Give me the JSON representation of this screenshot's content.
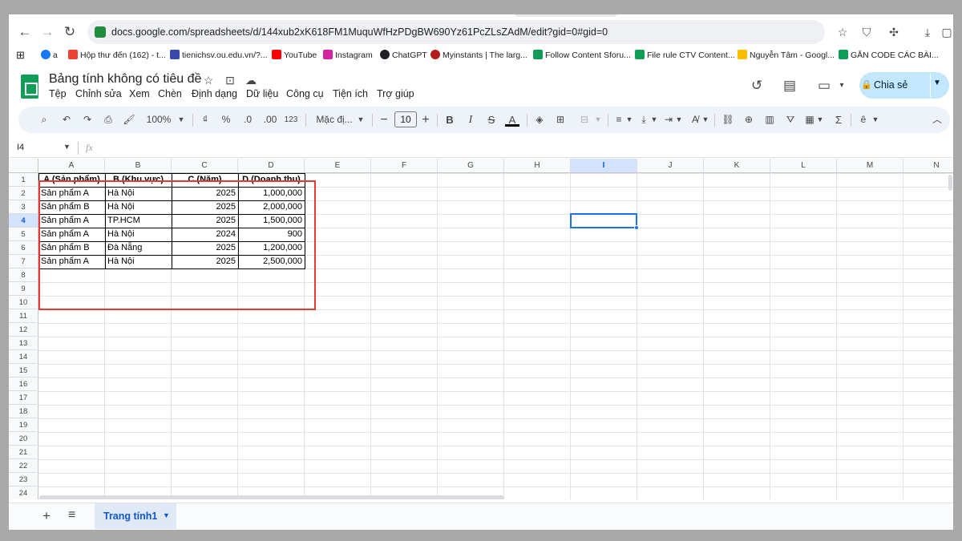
{
  "browser": {
    "url": "docs.google.com/spreadsheets/d/144xub2xK618FM1MuquWfHzPDgBW690Yz61PcZLsZAdM/edit?gid=0#gid=0",
    "bookmarks": [
      {
        "label": "a",
        "icon": "facebook-icon",
        "color": "#1877f2"
      },
      {
        "label": "Hộp thư đến (162) - t...",
        "icon": "gmail-icon",
        "color": "#ea4335"
      },
      {
        "label": "tienichsv.ou.edu.vn/?...",
        "icon": "edge-icon",
        "color": "#3949ab"
      },
      {
        "label": "YouTube",
        "icon": "youtube-icon",
        "color": "#ff0000"
      },
      {
        "label": "Instagram",
        "icon": "instagram-icon",
        "color": "#d6249f"
      },
      {
        "label": "ChatGPT",
        "icon": "chatgpt-icon",
        "color": "#202124"
      },
      {
        "label": "Myinstants | The larg...",
        "icon": "myinstants-icon",
        "color": "#b71c1c"
      },
      {
        "label": "Follow Content Sforu...",
        "icon": "sheets-icon",
        "color": "#0f9d58"
      },
      {
        "label": "File rule CTV Content...",
        "icon": "sheets-icon",
        "color": "#0f9d58"
      },
      {
        "label": "Nguyễn Tâm - Googl...",
        "icon": "drive-icon",
        "color": "#fbbc04"
      },
      {
        "label": "GẮN CODE CÁC BÀI...",
        "icon": "sheets-icon",
        "color": "#0f9d58"
      }
    ]
  },
  "doc": {
    "title": "Bảng tính không có tiêu đề",
    "menu": [
      "Tệp",
      "Chỉnh sửa",
      "Xem",
      "Chèn",
      "Định dạng",
      "Dữ liệu",
      "Công cụ",
      "Tiện ích",
      "Trợ giúp"
    ],
    "share_label": "Chia sẻ"
  },
  "toolbar": {
    "zoom": "100%",
    "currency": "₫",
    "percent": "%",
    "dec_decrease": ".0",
    "dec_increase": ".00",
    "number_format": "123",
    "font": "Mặc đị...",
    "font_size": "10",
    "bold": "B",
    "italic": "I",
    "strike": "S",
    "text_color": "A",
    "sum": "Σ"
  },
  "formula_bar": {
    "namebox": "I4",
    "fx": "fx"
  },
  "grid": {
    "columns": [
      "A",
      "B",
      "C",
      "D",
      "E",
      "F",
      "G",
      "H",
      "I",
      "J",
      "K",
      "L",
      "M",
      "N"
    ],
    "selected_column": "I",
    "rows": [
      "1",
      "2",
      "3",
      "4",
      "5",
      "6",
      "7",
      "8",
      "9",
      "10",
      "11",
      "12",
      "13",
      "14",
      "15",
      "16",
      "17",
      "18",
      "19",
      "20",
      "21",
      "22",
      "23",
      "24"
    ],
    "selected_row": "4",
    "table": {
      "header": [
        "A (Sản phẩm)",
        "B (Khu vực)",
        "C (Năm)",
        "D (Doanh thu)"
      ],
      "rows": [
        [
          "Sản phẩm A",
          "Hà Nội",
          "2025",
          "1,000,000"
        ],
        [
          "Sản phẩm B",
          "Hà Nội",
          "2025",
          "2,000,000"
        ],
        [
          "Sản phẩm A",
          "TP.HCM",
          "2025",
          "1,500,000"
        ],
        [
          "Sản phẩm A",
          "Hà Nội",
          "2024",
          "900"
        ],
        [
          "Sản phẩm B",
          "Đà Nẵng",
          "2025",
          "1,200,000"
        ],
        [
          "Sản phẩm A",
          "Hà Nội",
          "2025",
          "2,500,000"
        ]
      ]
    },
    "highlight_color": "#e53935",
    "selection_color": "#1a73e8"
  },
  "sheets": {
    "add_icon": "+",
    "list_icon": "≡",
    "active_tab": "Trang tính1"
  }
}
